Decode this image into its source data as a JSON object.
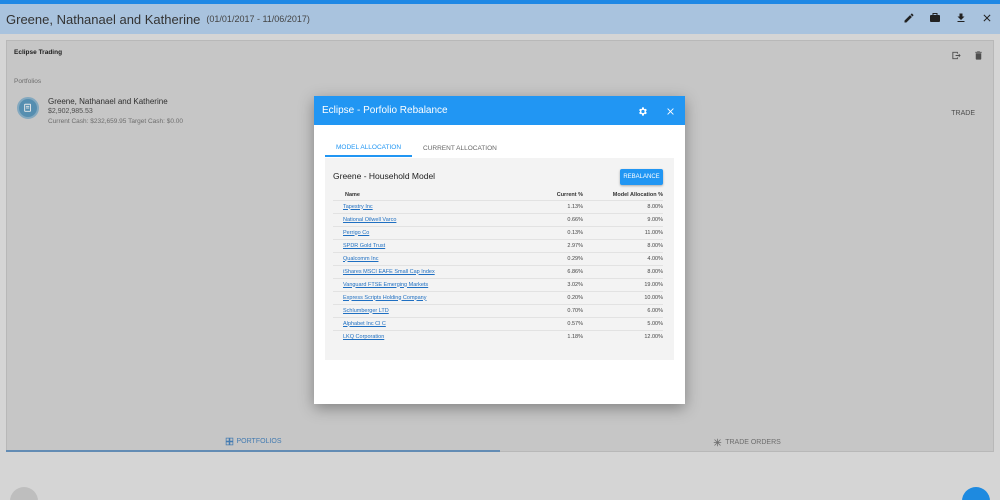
{
  "app": {
    "title": "Greene, Nathanael and Katherine",
    "date_range": "(01/01/2017 - 11/06/2017)",
    "actions": [
      "edit-icon",
      "briefcase-icon",
      "download-icon",
      "close-icon"
    ]
  },
  "card": {
    "section_title": "Eclipse Trading",
    "portfolios_label": "Portfolios",
    "portfolio": {
      "name": "Greene, Nathanael and Katherine",
      "value": "$2,902,985.53",
      "cash": "Current Cash: $232,659.95  Target Cash: $0.00",
      "trade_label": "TRADE"
    }
  },
  "bottom_tabs": {
    "portfolios": "PORTFOLIOS",
    "trade_orders": "TRADE ORDERS"
  },
  "modal": {
    "title": "Eclipse - Porfolio Rebalance",
    "tabs": [
      "MODEL ALLOCATION",
      "CURRENT ALLOCATION"
    ],
    "panel_title": "Greene - Household Model",
    "rebalance_label": "REBALANCE",
    "columns": {
      "name": "Name",
      "current": "Current %",
      "model": "Model Allocation %"
    },
    "rows": [
      {
        "name": "Tapestry Inc",
        "current": "1.13%",
        "model": "8.00%",
        "color": "#1e88e5"
      },
      {
        "name": "National Oilwell Varco",
        "current": "0.66%",
        "model": "9.00%",
        "color": "#3949ab"
      },
      {
        "name": "Perrigo Co",
        "current": "0.13%",
        "model": "11.00%",
        "color": "#1565c0"
      },
      {
        "name": "SPDR Gold Trust",
        "current": "2.97%",
        "model": "8.00%",
        "color": "#90caf9"
      },
      {
        "name": "Qualcomm Inc",
        "current": "0.29%",
        "model": "4.00%",
        "color": "#5c6bc0"
      },
      {
        "name": "iShares MSCI EAFE Small Cap Index",
        "current": "6.86%",
        "model": "8.00%",
        "color": "#6a1b9a"
      },
      {
        "name": "Vanguard FTSE Emerging Markets",
        "current": "3.02%",
        "model": "19.00%",
        "color": "#1e88e5"
      },
      {
        "name": "Express Scripts Holding Company",
        "current": "0.20%",
        "model": "10.00%",
        "color": "#64b5f6"
      },
      {
        "name": "Schlumberger LTD",
        "current": "0.70%",
        "model": "6.00%",
        "color": "#7e57c2"
      },
      {
        "name": "Alphabet Inc Cl C",
        "current": "0.57%",
        "model": "5.00%",
        "color": "#283593"
      },
      {
        "name": "LKQ Corporation",
        "current": "1.18%",
        "model": "12.00%",
        "color": "#42a5f5"
      }
    ]
  }
}
